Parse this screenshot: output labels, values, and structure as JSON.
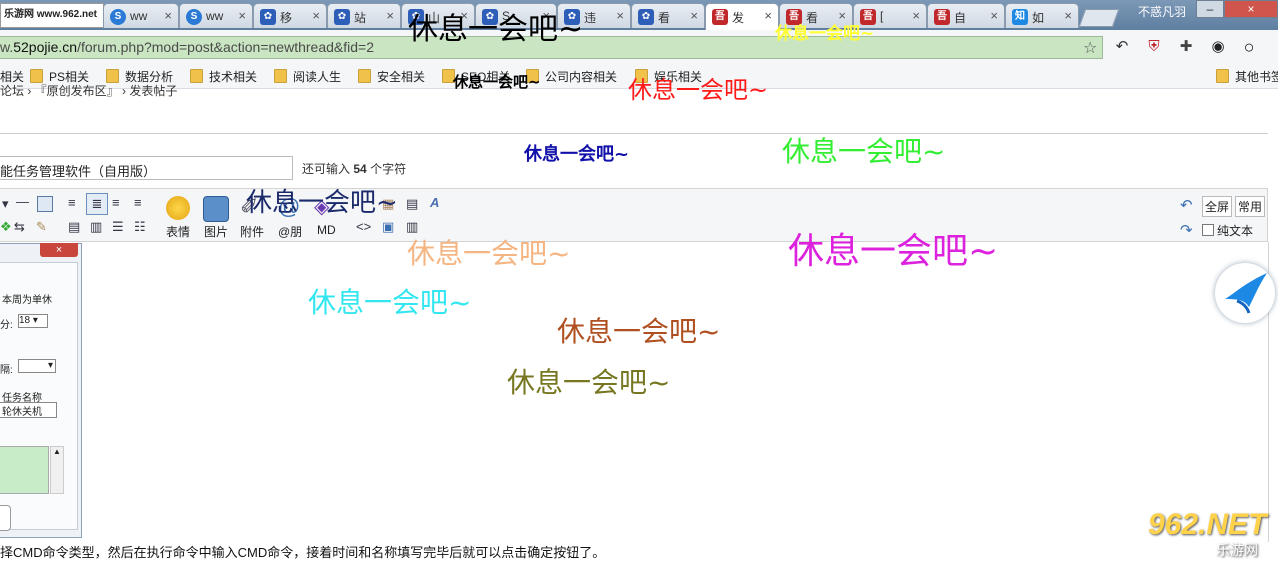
{
  "tabs": [
    {
      "title": "乐游网 www.962.net",
      "icon": "logo-icon"
    },
    {
      "title": "ww",
      "icon": "s-icon",
      "color": "#2b7ad6"
    },
    {
      "title": "ww",
      "icon": "s-icon",
      "color": "#2b7ad6"
    },
    {
      "title": "移",
      "icon": "paw-icon",
      "color": "#2e5fb8"
    },
    {
      "title": "站",
      "icon": "paw-icon",
      "color": "#2e5fb8"
    },
    {
      "title": "山",
      "icon": "paw-icon",
      "color": "#2e5fb8"
    },
    {
      "title": "S",
      "icon": "paw-icon",
      "color": "#2e5fb8"
    },
    {
      "title": "违",
      "icon": "paw-icon",
      "color": "#2e5fb8"
    },
    {
      "title": "看",
      "icon": "paw-icon",
      "color": "#2e5fb8"
    },
    {
      "title": "发",
      "icon": "52pojie-icon",
      "color": "#c0282c"
    },
    {
      "title": "看",
      "icon": "52pojie-icon",
      "color": "#c0282c"
    },
    {
      "title": "[",
      "icon": "52pojie-icon",
      "color": "#c0282c"
    },
    {
      "title": "自",
      "icon": "52pojie-icon",
      "color": "#c0282c"
    },
    {
      "title": "如",
      "icon": "zhihu-icon",
      "color": "#1e88e5"
    }
  ],
  "window": {
    "user": "不惑凡羽",
    "min": "–",
    "close": "×"
  },
  "address": {
    "prefix": "w.",
    "host": "52pojie.cn",
    "path": "/forum.php?mod=post&action=newthread&fid=2"
  },
  "bookmarks": [
    "相关",
    "PS相关",
    "数据分析",
    "技术相关",
    "阅读人生",
    "安全相关",
    "SEO相关",
    "公司内容相关",
    "娱乐相关",
    "其他书签"
  ],
  "breadcrumb": "论坛 › 『原创发布区』 › 发表帖子",
  "subject": {
    "value": "能任务管理软件（自用版）",
    "remain_prefix": "还可输入",
    "remain_count": "54",
    "remain_suffix": "个字符"
  },
  "toolbar": {
    "emoji": "表情",
    "image": "图片",
    "attach": "附件",
    "at": "@朋",
    "md": "MD",
    "fullscreen": "全屏",
    "common": "常用",
    "plaintext": "纯文本"
  },
  "dialog": {
    "close": "×",
    "weekly": "本周为单休",
    "minute_label": "分:",
    "minute_value": "18",
    "interval_label": "隔:",
    "task_name_label": "任务名称",
    "task_name_value": "轮休关机"
  },
  "bottom_text": "择CMD命令类型，然后在执行命令中输入CMD命令，接着时间和名称填写完毕后就可以点击确定按钮了。",
  "watermark": {
    "brand": "962.NET",
    "sub": "乐游网"
  },
  "danmaku": [
    {
      "text": "休息一会吧~",
      "color": "#000000"
    },
    {
      "text": "休息一会吧~",
      "color": "#ffff33"
    },
    {
      "text": "休息一会吧~",
      "color": "#000000"
    },
    {
      "text": "休息一会吧~",
      "color": "#ff1a1a"
    },
    {
      "text": "休息一会吧~",
      "color": "#1111aa"
    },
    {
      "text": "休息一会吧~",
      "color": "#33ee33"
    },
    {
      "text": "休息一会吧~",
      "color": "#1a2a6a"
    },
    {
      "text": "休息一会吧~",
      "color": "#f5b583"
    },
    {
      "text": "休息一会吧~",
      "color": "#dd22dd"
    },
    {
      "text": "休息一会吧~",
      "color": "#33e6f0"
    },
    {
      "text": "休息一会吧~",
      "color": "#b05020"
    },
    {
      "text": "休息一会吧~",
      "color": "#777722"
    }
  ]
}
